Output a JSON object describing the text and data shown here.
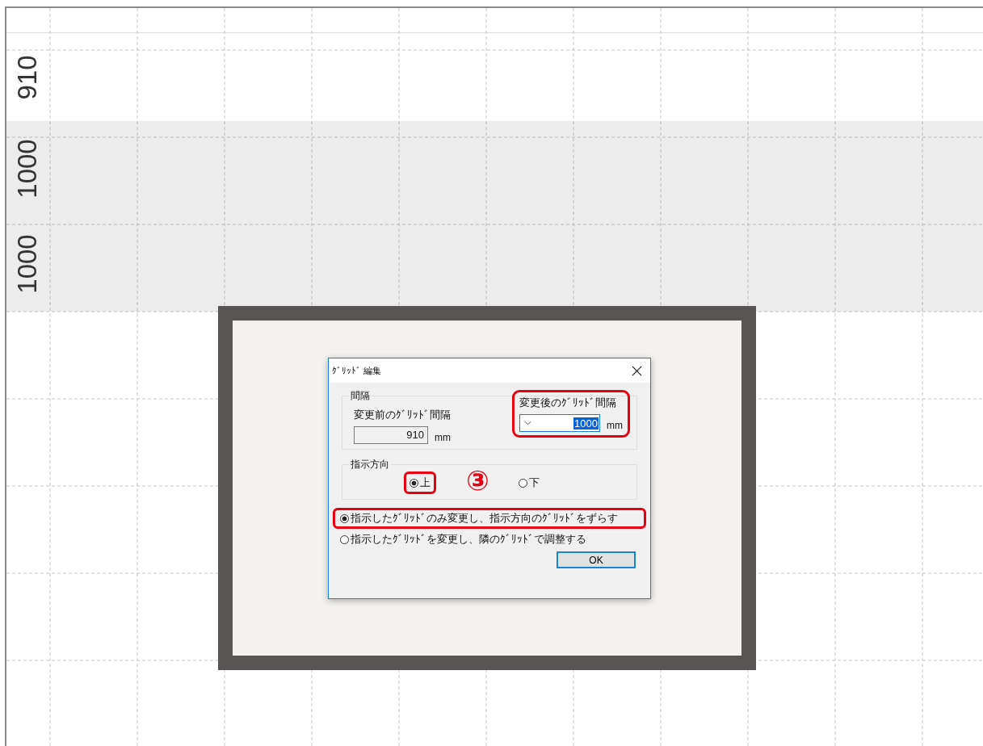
{
  "ruler_rows": [
    {
      "label": "910",
      "shaded": false
    },
    {
      "label": "1000",
      "shaded": true
    },
    {
      "label": "1000",
      "shaded": true
    }
  ],
  "dialog": {
    "title": "ｸﾞﾘｯﾄﾞ 編集",
    "interval_group": {
      "label": "間隔",
      "before": {
        "label": "変更前のｸﾞﾘｯﾄﾞ間隔",
        "value": "910",
        "unit": "mm",
        "readonly": true
      },
      "after": {
        "label": "変更後のｸﾞﾘｯﾄﾞ間隔",
        "value": "1000",
        "unit": "mm",
        "value_selected": true,
        "highlighted": true
      }
    },
    "direction_group": {
      "label": "指示方向",
      "options": [
        {
          "label": "上",
          "selected": true,
          "highlighted": true
        },
        {
          "label": "下",
          "selected": false,
          "highlighted": false
        }
      ]
    },
    "mode_options": [
      {
        "label": "指示したｸﾞﾘｯﾄﾞのみ変更し、指示方向のｸﾞﾘｯﾄﾞをずらす",
        "selected": true,
        "highlighted": true
      },
      {
        "label": "指示したｸﾞﾘｯﾄﾞを変更し、隣のｸﾞﾘｯﾄﾞで調整する",
        "selected": false,
        "highlighted": false
      }
    ],
    "button": "OK"
  },
  "step_marker": "③"
}
